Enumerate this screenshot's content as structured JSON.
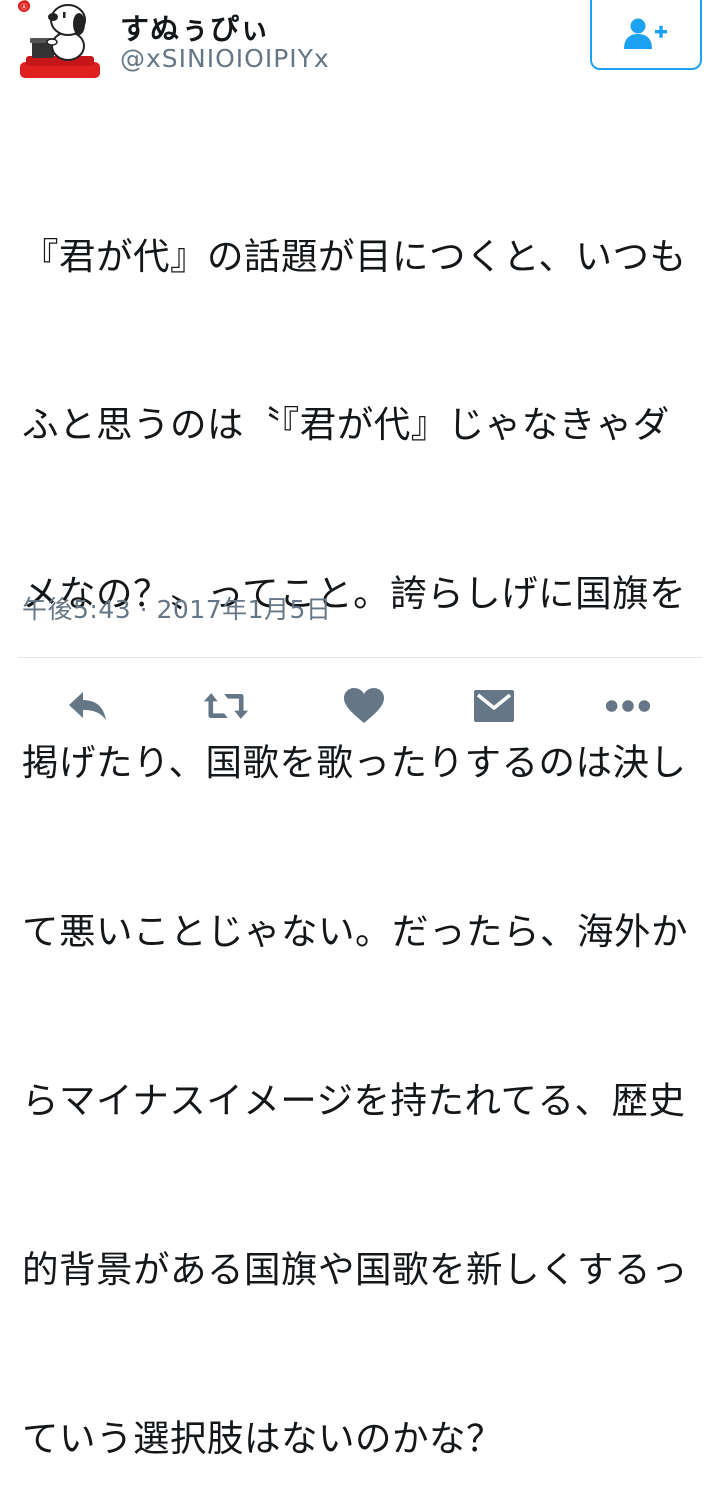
{
  "tweet": {
    "author": {
      "display_name": "すぬぅぴぃ",
      "handle": "@xSINIOIOIPIYx",
      "avatar_icon": "snoopy-typewriter-avatar"
    },
    "follow_button": {
      "icon": "follow-user-plus-icon",
      "accent_color": "#1da1f2"
    },
    "text_lines": [
      "『君が代』の話題が目につくと、いつも",
      "ふと思うのは〝『君が代』じゃなきゃダ",
      "メなの？〟ってこと。誇らしげに国旗を",
      "掲げたり、国歌を歌ったりするのは決し",
      "て悪いことじゃない。だったら、海外か",
      "らマイナスイメージを持たれてる、歴史",
      "的背景がある国旗や国歌を新しくするっ",
      "ていう選択肢はないのかな？"
    ],
    "timestamp": "午後5:43 · 2017年1月5日"
  },
  "actions": [
    {
      "name": "reply",
      "icon": "reply-icon"
    },
    {
      "name": "retweet",
      "icon": "retweet-icon"
    },
    {
      "name": "like",
      "icon": "heart-icon"
    },
    {
      "name": "direct-message",
      "icon": "envelope-icon"
    },
    {
      "name": "more",
      "icon": "more-dots-icon"
    }
  ],
  "colors": {
    "text": "#14171a",
    "secondary_text": "#657786",
    "icon_gray": "#657786",
    "divider": "#e1e8ed",
    "accent": "#1da1f2"
  }
}
